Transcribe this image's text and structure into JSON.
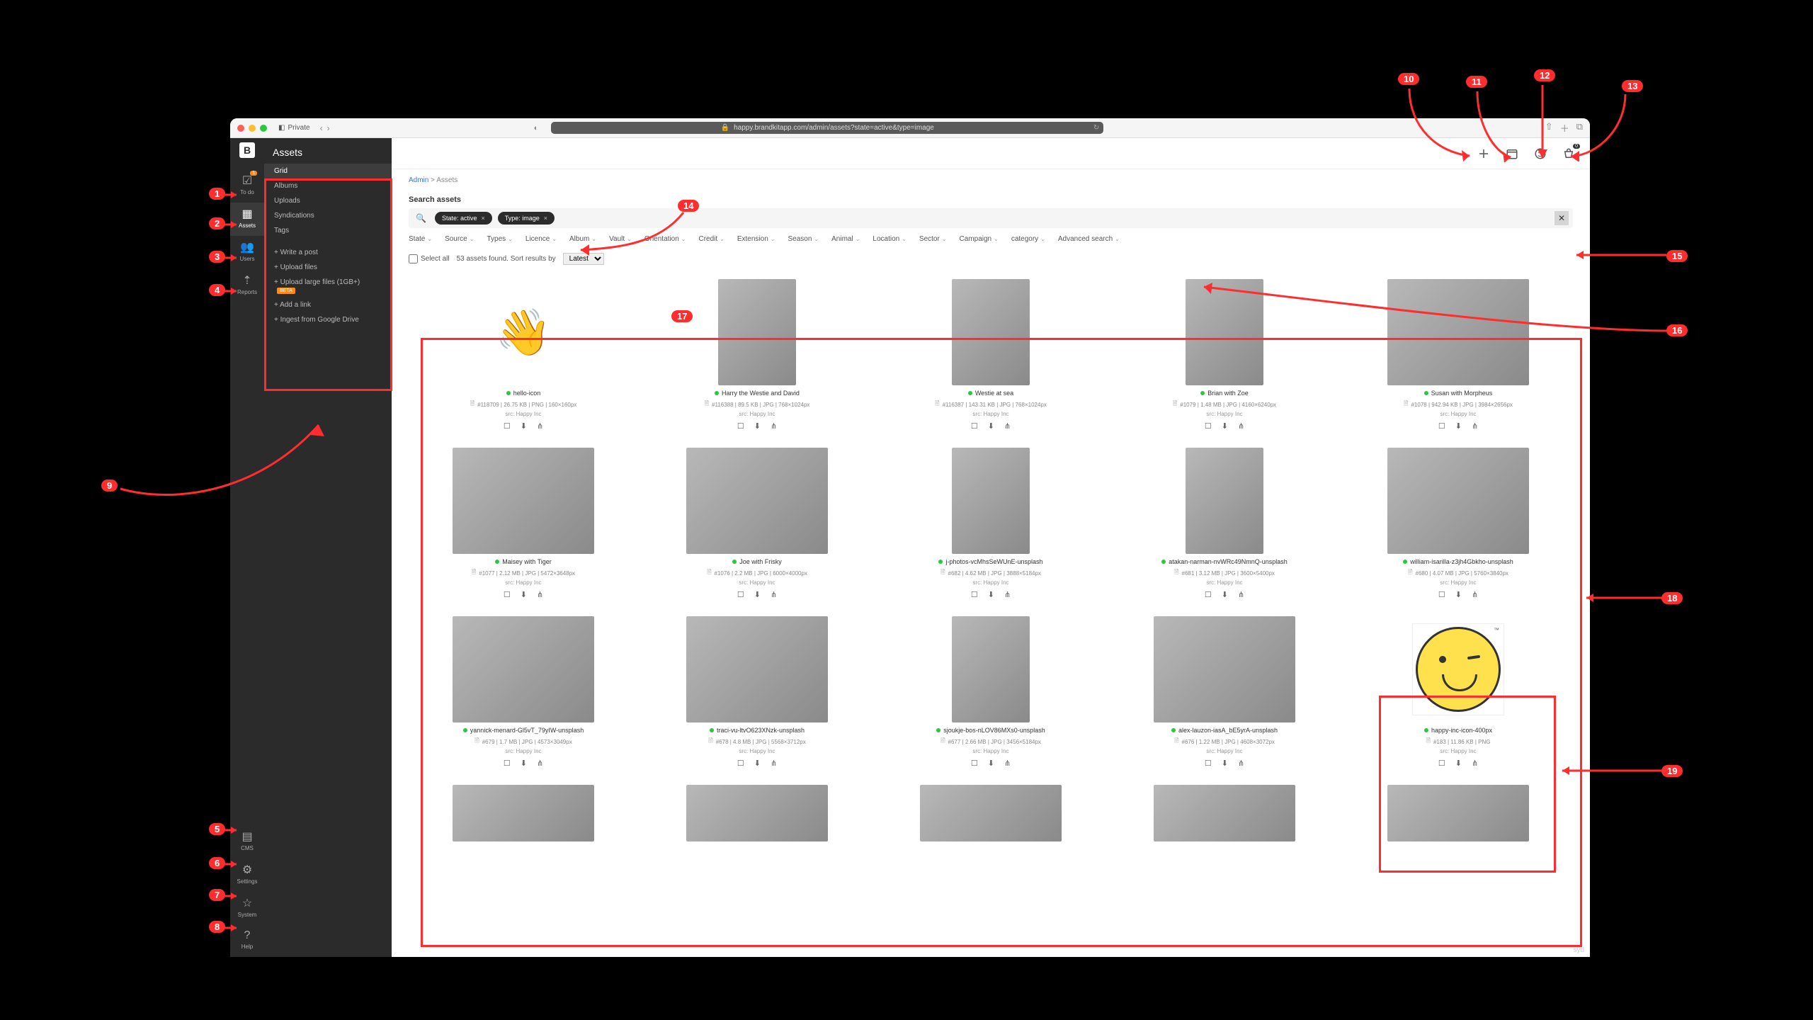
{
  "browser": {
    "private_label": "Private",
    "url": "happy.brandkitapp.com/admin/assets?state=active&type=image"
  },
  "rail": {
    "items": [
      {
        "icon": "☑",
        "label": "To do",
        "badge": "1"
      },
      {
        "icon": "▦",
        "label": "Assets"
      },
      {
        "icon": "👥",
        "label": "Users"
      },
      {
        "icon": "⇡",
        "label": "Reports"
      }
    ],
    "bottom": [
      {
        "icon": "▤",
        "label": "CMS"
      },
      {
        "icon": "⚙",
        "label": "Settings"
      },
      {
        "icon": "☆",
        "label": "System"
      },
      {
        "icon": "?",
        "label": "Help"
      }
    ]
  },
  "panel": {
    "title": "Assets",
    "items": [
      "Grid",
      "Albums",
      "Uploads",
      "Syndications",
      "Tags"
    ],
    "actions": [
      "+ Write a post",
      "+ Upload files",
      "+ Upload large files (1GB+)",
      "+ Add a link",
      "+ Ingest from Google Drive"
    ],
    "beta_label": "BETA"
  },
  "topbar": {
    "basket_count": "0"
  },
  "crumbs": {
    "root": "Admin",
    "sep": ">",
    "current": "Assets"
  },
  "search": {
    "label": "Search assets",
    "chips": [
      {
        "label": "State: active"
      },
      {
        "label": "Type: image"
      }
    ]
  },
  "filters": [
    "State",
    "Source",
    "Types",
    "Licence",
    "Album",
    "Vault",
    "Orientation",
    "Credit",
    "Extension",
    "Season",
    "Animal",
    "Location",
    "Sector",
    "Campaign",
    "category",
    "Advanced search"
  ],
  "results": {
    "select_all": "Select all",
    "count_text": "53 assets found. Sort results by",
    "sort": "Latest"
  },
  "cards": [
    {
      "title": "hello-icon",
      "meta": "#118709 | 26.75 KB | PNG | 160×160px",
      "src": "src: Happy Inc",
      "variant": "wave",
      "shape": "sq"
    },
    {
      "title": "Harry the Westie and David",
      "meta": "#116388 | 89.5 KB | JPG | 768×1024px",
      "src": "src: Happy Inc",
      "variant": "person1",
      "shape": "port"
    },
    {
      "title": "Westie at sea",
      "meta": "#116387 | 143.31 KB | JPG | 768×1024px",
      "src": "src: Happy Inc",
      "variant": "sea",
      "shape": "port"
    },
    {
      "title": "Brian with Zoe",
      "meta": "#1079 | 1.48 MB | JPG | 4160×6240px",
      "src": "src: Happy Inc",
      "variant": "person2",
      "shape": "port"
    },
    {
      "title": "Susan with Morpheus",
      "meta": "#1078 | 942.94 KB | JPG | 3984×2656px",
      "src": "src: Happy Inc",
      "variant": "person3",
      "shape": "land"
    },
    {
      "title": "Maisey with Tiger",
      "meta": "#1077 | 2.12 MB | JPG | 5472×3648px",
      "src": "src: Happy Inc",
      "variant": "person4",
      "shape": "land"
    },
    {
      "title": "Joe with Frisky",
      "meta": "#1076 | 2.2 MB | JPG | 6000×4000px",
      "src": "src: Happy Inc",
      "variant": "autumn",
      "shape": "land"
    },
    {
      "title": "j-photos-vcMhsSeWUnE-unsplash",
      "meta": "#682 | 4.62 MB | JPG | 3888×5184px",
      "src": "src: Happy Inc",
      "variant": "sq1",
      "shape": "port"
    },
    {
      "title": "atakan-narman-nvWRc49NmnQ-unsplash",
      "meta": "#681 | 3.12 MB | JPG | 3600×5400px",
      "src": "src: Happy Inc",
      "variant": "sq2",
      "shape": "port"
    },
    {
      "title": "william-isarilla-z3jh4Gbkho-unsplash",
      "meta": "#680 | 4.07 MB | JPG | 5760×3840px",
      "src": "src: Happy Inc",
      "variant": "sq4",
      "shape": "land"
    },
    {
      "title": "yannick-menard-Gl5vT_79yIW-unsplash",
      "meta": "#679 | 1.7 MB | JPG | 4573×3049px",
      "src": "src: Happy Inc",
      "variant": "sq1",
      "shape": "land"
    },
    {
      "title": "traci-vu-ltvO623XNzk-unsplash",
      "meta": "#678 | 4.8 MB | JPG | 5568×3712px",
      "src": "src: Happy Inc",
      "variant": "sq3",
      "shape": "land"
    },
    {
      "title": "sjoukje-bos-nLOV86MXs0-unsplash",
      "meta": "#677 | 2.66 MB | JPG | 3456×5184px",
      "src": "src: Happy Inc",
      "variant": "sq4",
      "shape": "port"
    },
    {
      "title": "alex-lauzon-iasA_bE5yrA-unsplash",
      "meta": "#676 | 1.22 MB | JPG | 4608×3072px",
      "src": "src: Happy Inc",
      "variant": "dark",
      "shape": "land"
    },
    {
      "title": "happy-inc-icon-400px",
      "meta": "#183 | 11.86 KB | PNG",
      "src": "src: Happy Inc",
      "variant": "wink",
      "shape": "sq"
    },
    {
      "title": "",
      "meta": "",
      "src": "",
      "variant": "sq2",
      "shape": "land",
      "partial": true
    },
    {
      "title": "",
      "meta": "",
      "src": "",
      "variant": "person2",
      "shape": "land",
      "partial": true
    },
    {
      "title": "",
      "meta": "",
      "src": "",
      "variant": "dark",
      "shape": "land",
      "partial": true
    },
    {
      "title": "",
      "meta": "",
      "src": "",
      "variant": "dark",
      "shape": "land",
      "partial": true
    },
    {
      "title": "",
      "meta": "",
      "src": "",
      "variant": "sq2",
      "shape": "land",
      "partial": true
    }
  ],
  "callouts": [
    "1",
    "2",
    "3",
    "4",
    "5",
    "6",
    "7",
    "8",
    "9",
    "10",
    "11",
    "12",
    "13",
    "14",
    "15",
    "16",
    "17",
    "18",
    "19"
  ],
  "watermark": "syd"
}
